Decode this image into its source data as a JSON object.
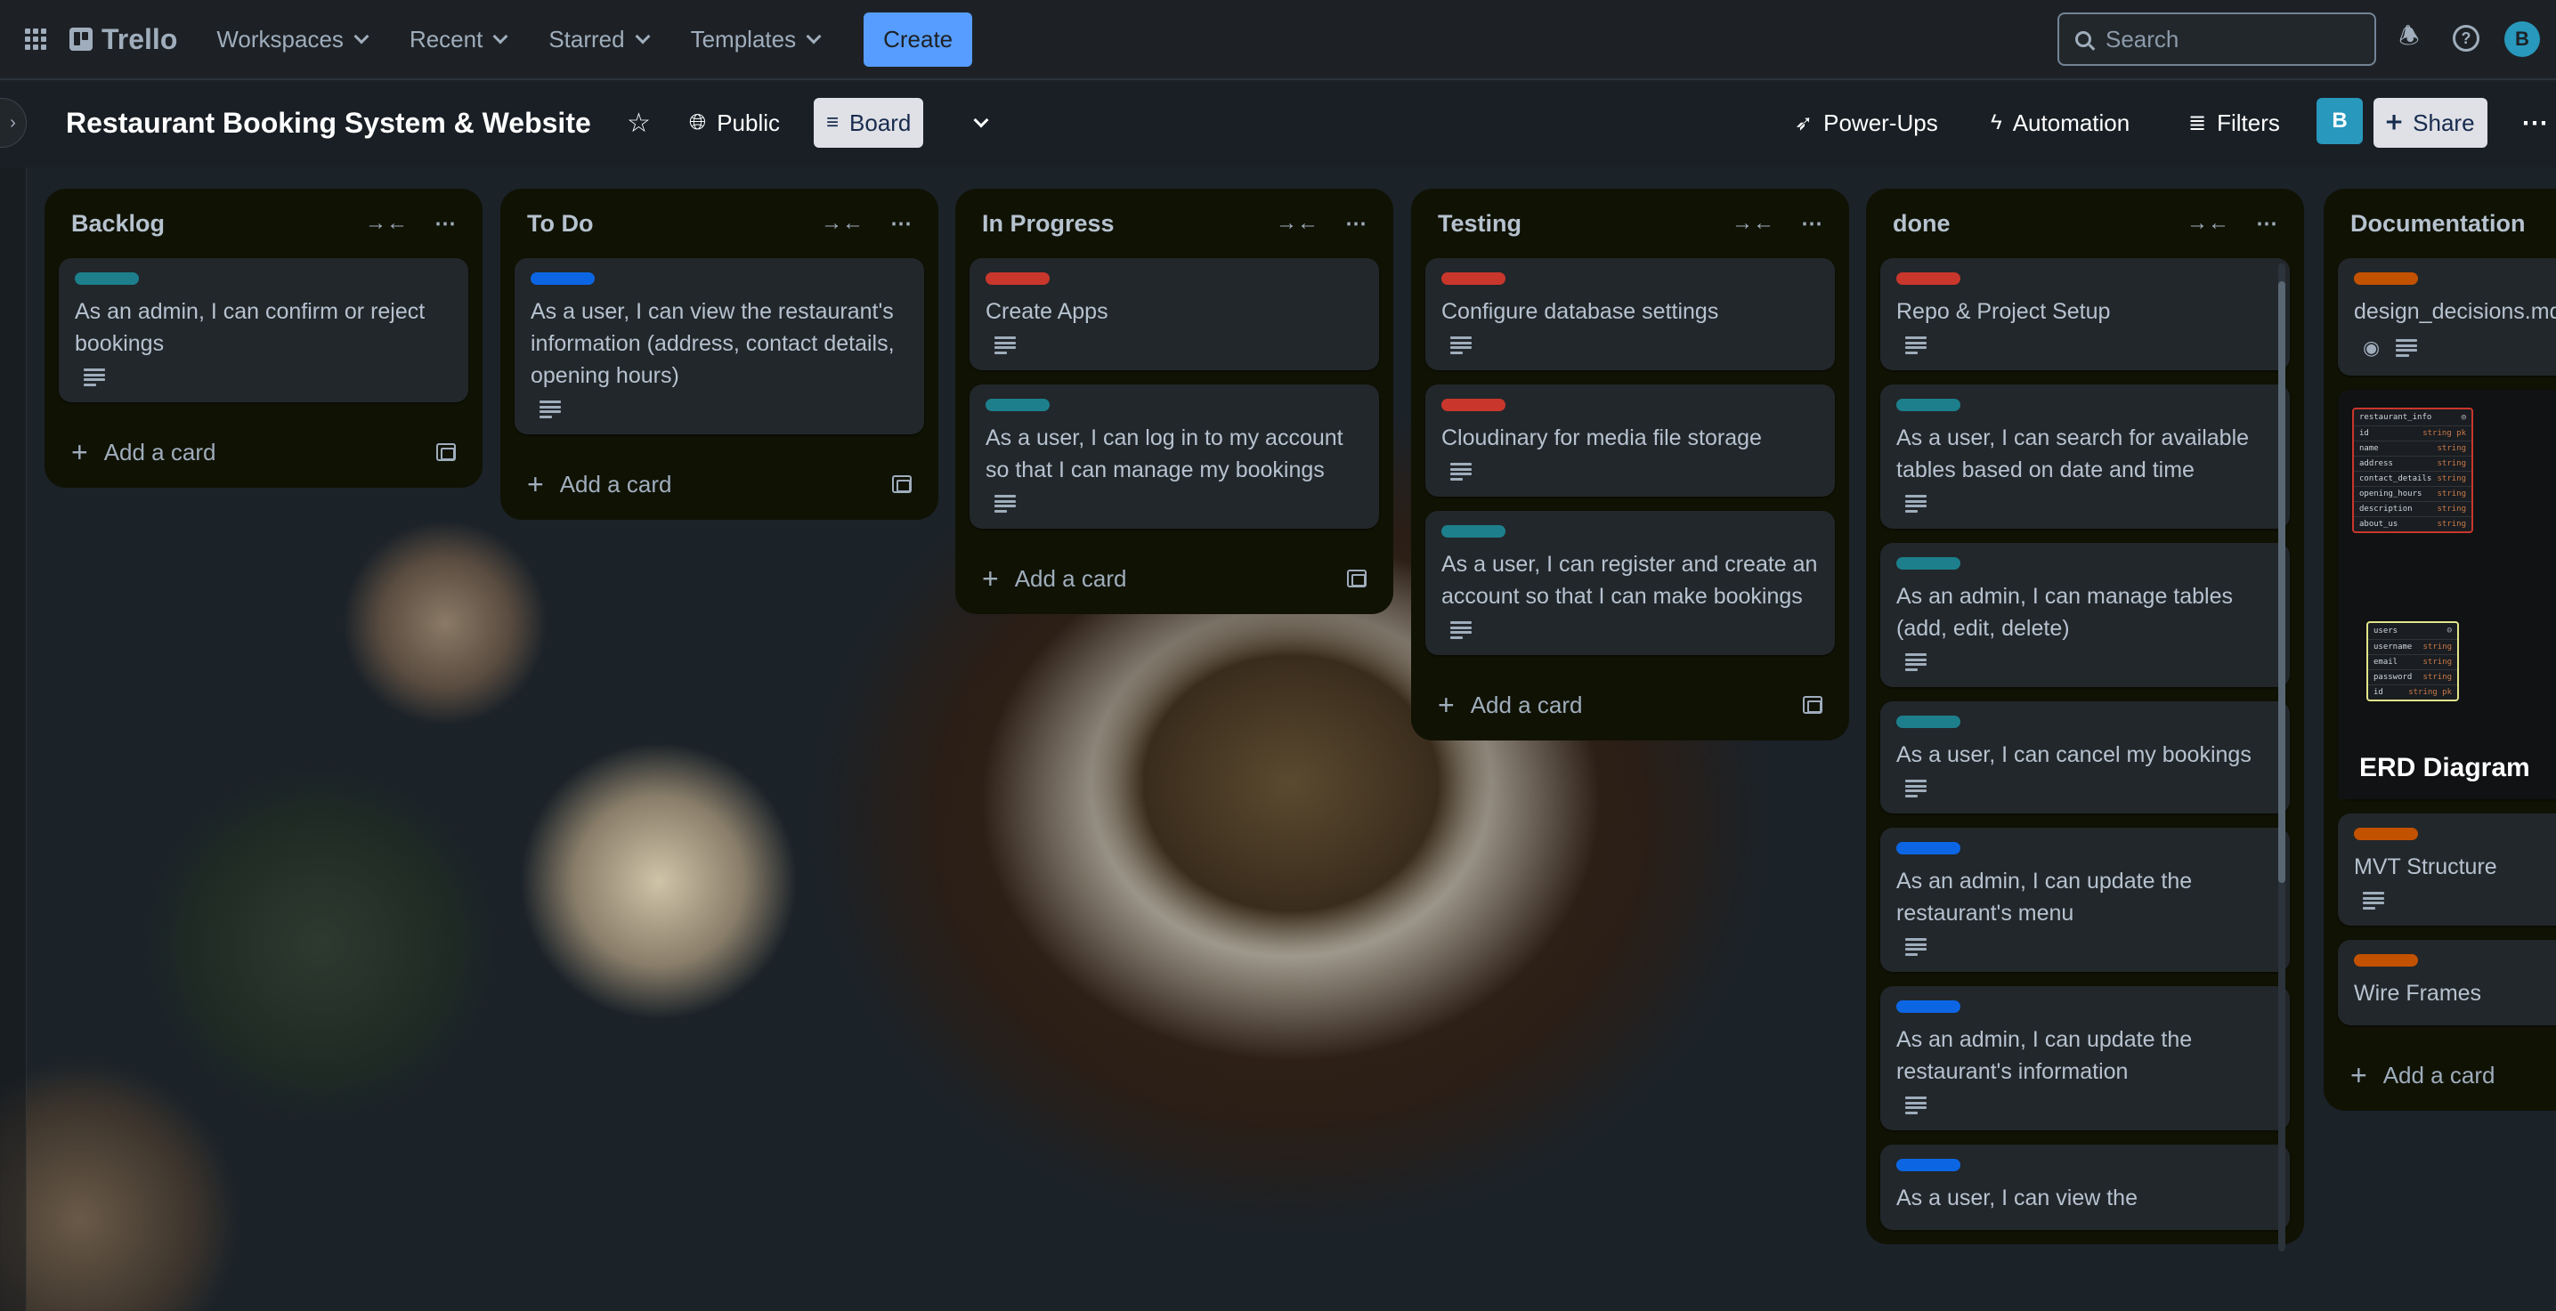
{
  "topbar": {
    "logo": "Trello",
    "nav": [
      "Workspaces",
      "Recent",
      "Starred",
      "Templates"
    ],
    "create_label": "Create",
    "search_placeholder": "Search",
    "avatar_initial": "B"
  },
  "board": {
    "title": "Restaurant Booking System & Website",
    "visibility": "Public",
    "view": "Board",
    "power_ups": "Power-Ups",
    "automation": "Automation",
    "filters": "Filters",
    "member_initial": "B",
    "share": "Share"
  },
  "lists": [
    {
      "title": "Backlog",
      "cards": [
        {
          "label_color": "#1d7f8c",
          "title": "As an admin, I can confirm or reject bookings"
        }
      ],
      "add_label": "Add a card"
    },
    {
      "title": "To Do",
      "cards": [
        {
          "label_color": "#0c66e4",
          "title": "As a user, I can view the restaurant's information (address, contact details, opening hours)"
        }
      ],
      "add_label": "Add a card"
    },
    {
      "title": "In Progress",
      "cards": [
        {
          "label_color": "#c9372c",
          "title": "Create Apps"
        },
        {
          "label_color": "#1d7f8c",
          "title": "As a user, I can log in to my account so that I can manage my bookings"
        }
      ],
      "add_label": "Add a card"
    },
    {
      "title": "Testing",
      "cards": [
        {
          "label_color": "#c9372c",
          "title": "Configure database settings"
        },
        {
          "label_color": "#c9372c",
          "title": "Cloudinary for media file storage"
        },
        {
          "label_color": "#1d7f8c",
          "title": "As a user, I can register and create an account so that I can make bookings"
        }
      ],
      "add_label": "Add a card"
    },
    {
      "title": "done",
      "cards": [
        {
          "label_color": "#c9372c",
          "title": "Repo & Project Setup"
        },
        {
          "label_color": "#1d7f8c",
          "title": "As a user, I can search for available tables based on date and time"
        },
        {
          "label_color": "#1d7f8c",
          "title": "As an admin, I can manage tables (add, edit, delete)"
        },
        {
          "label_color": "#1d7f8c",
          "title": "As a user, I can cancel my bookings"
        },
        {
          "label_color": "#0c66e4",
          "title": "As an admin, I can update the restaurant's menu"
        },
        {
          "label_color": "#0c66e4",
          "title": "As an admin, I can update the restaurant's information"
        },
        {
          "label_color": "#0c66e4",
          "title": "As a user, I can view the"
        }
      ],
      "add_label": "Add a card"
    },
    {
      "title": "Documentation",
      "cards": [
        {
          "label_color": "#c25100",
          "title": "design_decisions.md"
        },
        {
          "title": "ERD Diagram"
        },
        {
          "label_color": "#c25100",
          "title": "MVT Structure"
        },
        {
          "label_color": "#c25100",
          "title": "Wire Frames"
        }
      ],
      "add_label": "Add a card"
    }
  ],
  "erd": {
    "table1": {
      "name": "restaurant_info",
      "rows": [
        [
          "id",
          "string pk"
        ],
        [
          "name",
          "string"
        ],
        [
          "address",
          "string"
        ],
        [
          "contact_details",
          "string"
        ],
        [
          "opening_hours",
          "string"
        ],
        [
          "description",
          "string"
        ],
        [
          "about_us",
          "string"
        ]
      ]
    },
    "table2": {
      "name": "users",
      "rows": [
        [
          "username",
          "string"
        ],
        [
          "email",
          "string"
        ],
        [
          "password",
          "string"
        ],
        [
          "id",
          "string pk"
        ]
      ]
    }
  }
}
